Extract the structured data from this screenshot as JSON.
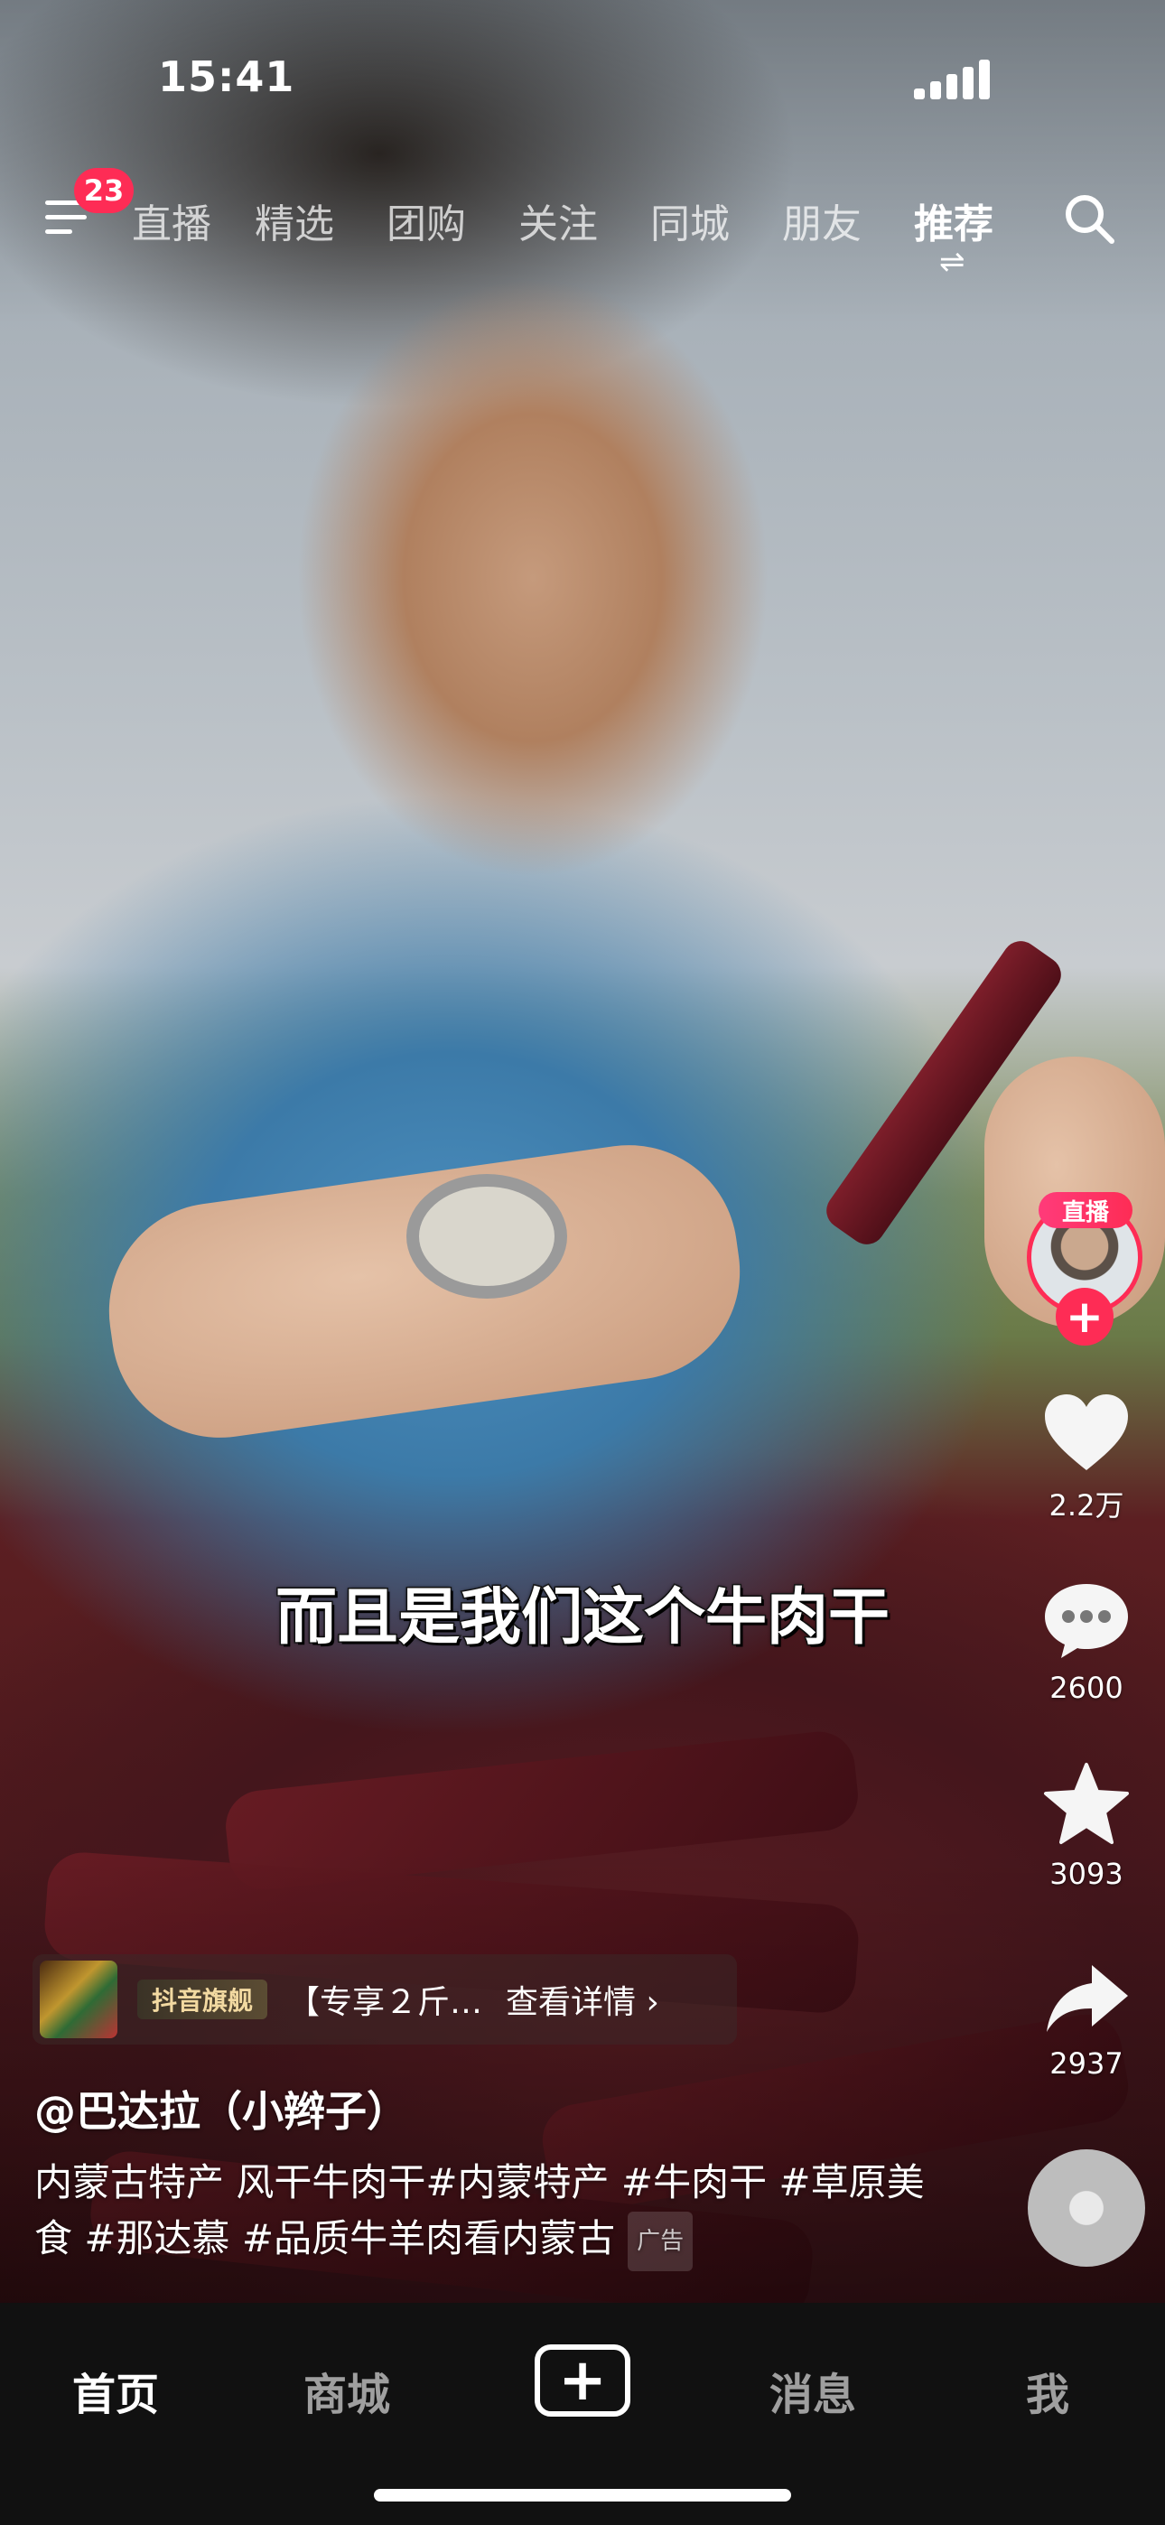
{
  "status_bar": {
    "time": "15:41"
  },
  "top_nav": {
    "notification_count": "23",
    "tabs": [
      {
        "label": "直播"
      },
      {
        "label": "精选"
      },
      {
        "label": "团购"
      },
      {
        "label": "关注"
      },
      {
        "label": "同城"
      },
      {
        "label": "朋友"
      },
      {
        "label": "推荐"
      }
    ],
    "active_tab": "推荐",
    "swap_glyph": "⇌"
  },
  "video": {
    "subtitle": "而且是我们这个牛肉干"
  },
  "right_rail": {
    "live_label": "直播",
    "follow_glyph": "+",
    "likes": "2.2万",
    "comments": "2600",
    "favorites": "3093",
    "shares": "2937"
  },
  "product_card": {
    "store_badge": "抖音旗舰",
    "title": "【专享２斤…",
    "link": "查看详情 ›"
  },
  "post": {
    "author": "@巴达拉（小辫子）",
    "description": "内蒙古特产 风干牛肉干#内蒙特产 #牛肉干 #草原美食 #那达慕 #品质牛羊肉看内蒙古",
    "ad_label": "广告"
  },
  "bottom_nav": {
    "home": "首页",
    "mall": "商城",
    "create": "+",
    "messages": "消息",
    "me": "我"
  },
  "colors": {
    "accent": "#fe2c55",
    "nav_bg": "#111111"
  }
}
